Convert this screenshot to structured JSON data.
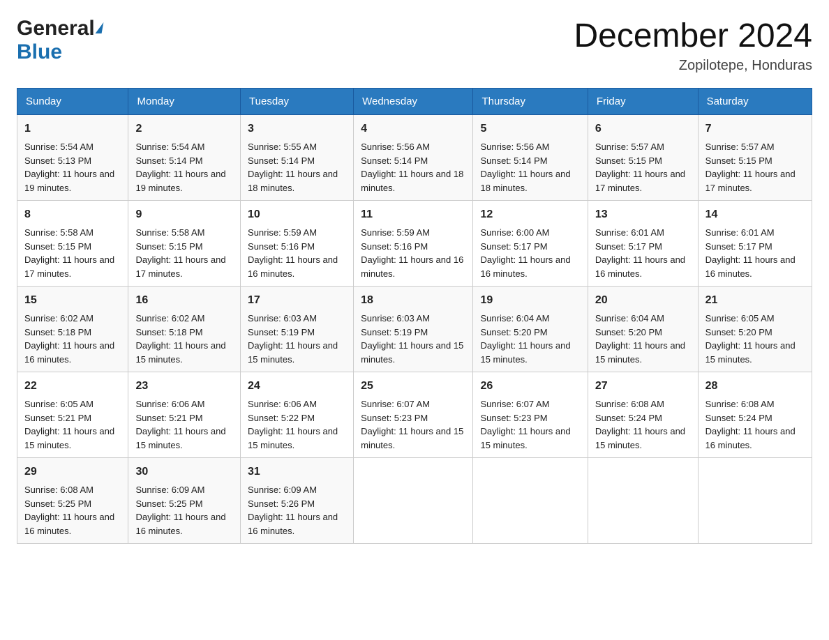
{
  "header": {
    "logo": {
      "general": "General",
      "blue": "Blue"
    },
    "title": "December 2024",
    "subtitle": "Zopilotepe, Honduras"
  },
  "weekdays": [
    "Sunday",
    "Monday",
    "Tuesday",
    "Wednesday",
    "Thursday",
    "Friday",
    "Saturday"
  ],
  "weeks": [
    [
      {
        "day": "1",
        "sunrise": "5:54 AM",
        "sunset": "5:13 PM",
        "daylight": "11 hours and 19 minutes."
      },
      {
        "day": "2",
        "sunrise": "5:54 AM",
        "sunset": "5:14 PM",
        "daylight": "11 hours and 19 minutes."
      },
      {
        "day": "3",
        "sunrise": "5:55 AM",
        "sunset": "5:14 PM",
        "daylight": "11 hours and 18 minutes."
      },
      {
        "day": "4",
        "sunrise": "5:56 AM",
        "sunset": "5:14 PM",
        "daylight": "11 hours and 18 minutes."
      },
      {
        "day": "5",
        "sunrise": "5:56 AM",
        "sunset": "5:14 PM",
        "daylight": "11 hours and 18 minutes."
      },
      {
        "day": "6",
        "sunrise": "5:57 AM",
        "sunset": "5:15 PM",
        "daylight": "11 hours and 17 minutes."
      },
      {
        "day": "7",
        "sunrise": "5:57 AM",
        "sunset": "5:15 PM",
        "daylight": "11 hours and 17 minutes."
      }
    ],
    [
      {
        "day": "8",
        "sunrise": "5:58 AM",
        "sunset": "5:15 PM",
        "daylight": "11 hours and 17 minutes."
      },
      {
        "day": "9",
        "sunrise": "5:58 AM",
        "sunset": "5:15 PM",
        "daylight": "11 hours and 17 minutes."
      },
      {
        "day": "10",
        "sunrise": "5:59 AM",
        "sunset": "5:16 PM",
        "daylight": "11 hours and 16 minutes."
      },
      {
        "day": "11",
        "sunrise": "5:59 AM",
        "sunset": "5:16 PM",
        "daylight": "11 hours and 16 minutes."
      },
      {
        "day": "12",
        "sunrise": "6:00 AM",
        "sunset": "5:17 PM",
        "daylight": "11 hours and 16 minutes."
      },
      {
        "day": "13",
        "sunrise": "6:01 AM",
        "sunset": "5:17 PM",
        "daylight": "11 hours and 16 minutes."
      },
      {
        "day": "14",
        "sunrise": "6:01 AM",
        "sunset": "5:17 PM",
        "daylight": "11 hours and 16 minutes."
      }
    ],
    [
      {
        "day": "15",
        "sunrise": "6:02 AM",
        "sunset": "5:18 PM",
        "daylight": "11 hours and 16 minutes."
      },
      {
        "day": "16",
        "sunrise": "6:02 AM",
        "sunset": "5:18 PM",
        "daylight": "11 hours and 15 minutes."
      },
      {
        "day": "17",
        "sunrise": "6:03 AM",
        "sunset": "5:19 PM",
        "daylight": "11 hours and 15 minutes."
      },
      {
        "day": "18",
        "sunrise": "6:03 AM",
        "sunset": "5:19 PM",
        "daylight": "11 hours and 15 minutes."
      },
      {
        "day": "19",
        "sunrise": "6:04 AM",
        "sunset": "5:20 PM",
        "daylight": "11 hours and 15 minutes."
      },
      {
        "day": "20",
        "sunrise": "6:04 AM",
        "sunset": "5:20 PM",
        "daylight": "11 hours and 15 minutes."
      },
      {
        "day": "21",
        "sunrise": "6:05 AM",
        "sunset": "5:20 PM",
        "daylight": "11 hours and 15 minutes."
      }
    ],
    [
      {
        "day": "22",
        "sunrise": "6:05 AM",
        "sunset": "5:21 PM",
        "daylight": "11 hours and 15 minutes."
      },
      {
        "day": "23",
        "sunrise": "6:06 AM",
        "sunset": "5:21 PM",
        "daylight": "11 hours and 15 minutes."
      },
      {
        "day": "24",
        "sunrise": "6:06 AM",
        "sunset": "5:22 PM",
        "daylight": "11 hours and 15 minutes."
      },
      {
        "day": "25",
        "sunrise": "6:07 AM",
        "sunset": "5:23 PM",
        "daylight": "11 hours and 15 minutes."
      },
      {
        "day": "26",
        "sunrise": "6:07 AM",
        "sunset": "5:23 PM",
        "daylight": "11 hours and 15 minutes."
      },
      {
        "day": "27",
        "sunrise": "6:08 AM",
        "sunset": "5:24 PM",
        "daylight": "11 hours and 15 minutes."
      },
      {
        "day": "28",
        "sunrise": "6:08 AM",
        "sunset": "5:24 PM",
        "daylight": "11 hours and 16 minutes."
      }
    ],
    [
      {
        "day": "29",
        "sunrise": "6:08 AM",
        "sunset": "5:25 PM",
        "daylight": "11 hours and 16 minutes."
      },
      {
        "day": "30",
        "sunrise": "6:09 AM",
        "sunset": "5:25 PM",
        "daylight": "11 hours and 16 minutes."
      },
      {
        "day": "31",
        "sunrise": "6:09 AM",
        "sunset": "5:26 PM",
        "daylight": "11 hours and 16 minutes."
      },
      null,
      null,
      null,
      null
    ]
  ],
  "labels": {
    "sunrise": "Sunrise:",
    "sunset": "Sunset:",
    "daylight": "Daylight:"
  }
}
